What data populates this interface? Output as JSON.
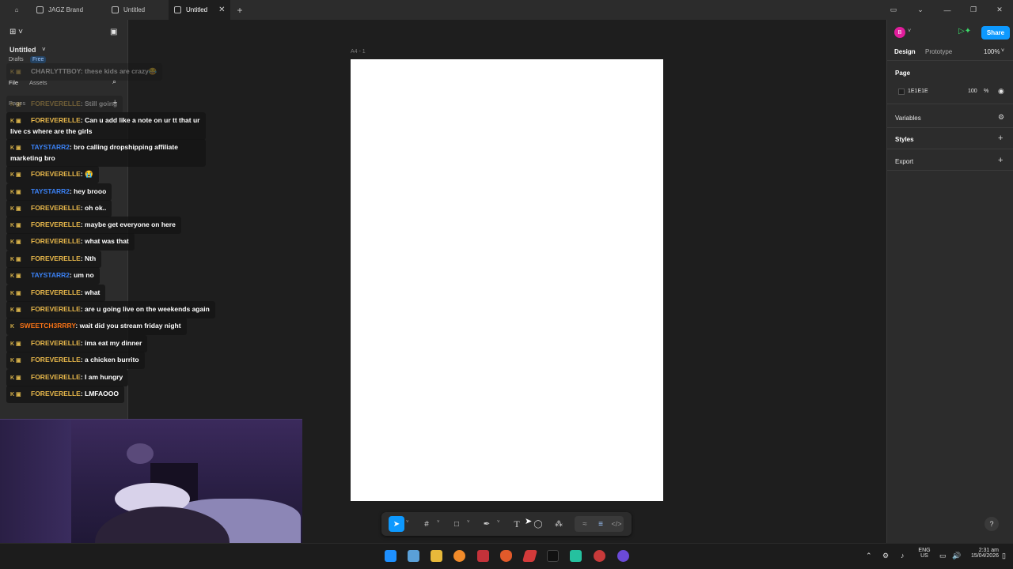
{
  "browser": {
    "tabs": [
      {
        "label": "JAGZ Brand",
        "active": false
      },
      {
        "label": "Untitled",
        "active": false
      },
      {
        "label": "Untitled",
        "active": true
      }
    ],
    "close_glyph": "✕",
    "new_tab_glyph": "+"
  },
  "left_panel": {
    "file_title": "Untitled",
    "drafts": "Drafts",
    "plan_badge": "Free",
    "tabs": [
      "File",
      "Assets"
    ],
    "pages_label": "Pages"
  },
  "chat": [
    {
      "user": "CHARLYTTBOY",
      "message": "these kids are crazy😂",
      "color": "#8a8a8a",
      "faded": true
    },
    {
      "user": "FOREVERELLE",
      "message": "Still going",
      "color": "#e8b84b",
      "faded": true
    },
    {
      "user": "FOREVERELLE",
      "message": "Can u add like a note on ur tt that ur live cs where are the girls",
      "color": "#e8b84b"
    },
    {
      "user": "TAYSTARR2",
      "message": "bro calling dropshipping affiliate marketing bro",
      "color": "#3b82f6"
    },
    {
      "user": "FOREVERELLE",
      "message": "😭",
      "color": "#e8b84b"
    },
    {
      "user": "TAYSTARR2",
      "message": "hey brooo",
      "color": "#3b82f6"
    },
    {
      "user": "FOREVERELLE",
      "message": "oh ok..",
      "color": "#e8b84b"
    },
    {
      "user": "FOREVERELLE",
      "message": "maybe get everyone on here",
      "color": "#e8b84b"
    },
    {
      "user": "FOREVERELLE",
      "message": "what was that",
      "color": "#e8b84b"
    },
    {
      "user": "FOREVERELLE",
      "message": "Nth",
      "color": "#e8b84b"
    },
    {
      "user": "TAYSTARR2",
      "message": "um no",
      "color": "#3b82f6"
    },
    {
      "user": "FOREVERELLE",
      "message": "what",
      "color": "#e8b84b"
    },
    {
      "user": "FOREVERELLE",
      "message": "are u going live on the weekends again",
      "color": "#e8b84b"
    },
    {
      "user": "SWEETCH3RRRY",
      "message": "wait did you stream friday night",
      "color": "#f97316"
    },
    {
      "user": "FOREVERELLE",
      "message": "ima eat my dinner",
      "color": "#e8b84b"
    },
    {
      "user": "FOREVERELLE",
      "message": "a chicken burrito",
      "color": "#e8b84b"
    },
    {
      "user": "FOREVERELLE",
      "message": "I am hungry",
      "color": "#e8b84b"
    },
    {
      "user": "FOREVERELLE",
      "message": "LMFAOOO",
      "color": "#e8b84b"
    }
  ],
  "canvas": {
    "frame_label": "A4 - 1"
  },
  "right_panel": {
    "avatar_letter": "B",
    "share_label": "Share",
    "tabs": [
      "Design",
      "Prototype"
    ],
    "zoom": "100%",
    "page_section": "Page",
    "page_color": "1E1E1E",
    "page_opacity": "100",
    "page_opacity_unit": "%",
    "variables": "Variables",
    "styles": "Styles",
    "export": "Export"
  },
  "toolbar": {
    "icons": [
      "move-tool",
      "frame-tool",
      "shape-tool",
      "pen-tool",
      "text-tool",
      "comment-tool",
      "actions-tool",
      "draw-mode",
      "design-mode",
      "dev-mode"
    ]
  },
  "help": "?",
  "taskbar": {
    "lang_top": "ENG",
    "lang_bottom": "US",
    "time": "2:31 am",
    "date": "15/04/2026"
  },
  "colors": {
    "accent": "#0d99ff",
    "panel": "#2c2c2c",
    "canvas": "#1e1e1e",
    "avatar": "#e11d9c"
  }
}
